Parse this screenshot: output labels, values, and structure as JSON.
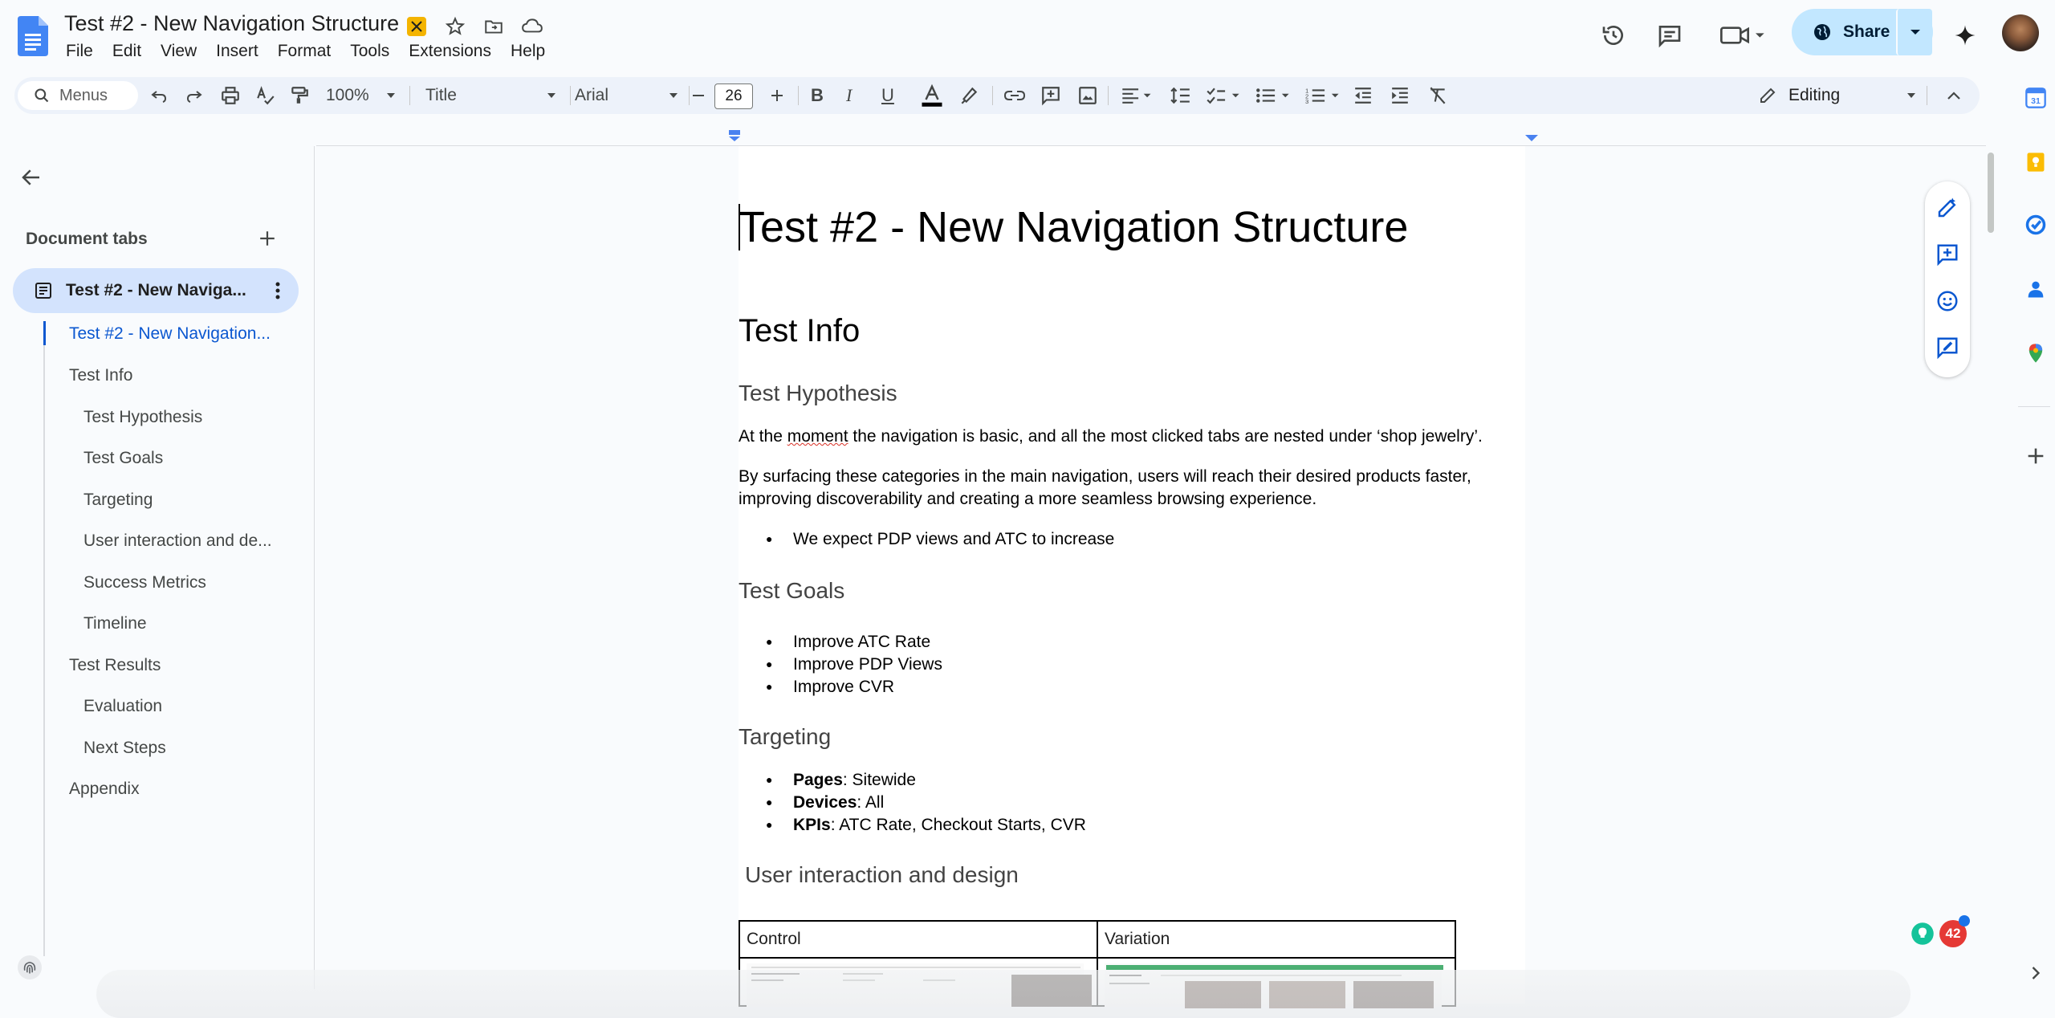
{
  "app": {
    "doc_title": "Test #2 - New Navigation Structure",
    "menu": [
      "File",
      "Edit",
      "View",
      "Insert",
      "Format",
      "Tools",
      "Extensions",
      "Help"
    ],
    "share_label": "Share"
  },
  "toolbar": {
    "menus_label": "Menus",
    "zoom": "100%",
    "style": "Title",
    "font": "Arial",
    "font_size": "26",
    "mode": "Editing"
  },
  "sidebar": {
    "heading": "Document tabs",
    "active_tab": "Test #2 - New Naviga...",
    "outline": [
      "Test #2 - New Navigation...",
      "Test Info",
      "Test Hypothesis",
      "Test Goals",
      "Targeting",
      "User interaction and de...",
      "Success Metrics",
      "Timeline",
      "Test Results",
      "Evaluation",
      "Next Steps",
      "Appendix"
    ]
  },
  "doc": {
    "title": "Test #2 - New Navigation Structure",
    "test_info": "Test Info",
    "hypothesis_heading": "Test Hypothesis",
    "hyp_p1_a": "At the ",
    "hyp_p1_b": "moment",
    "hyp_p1_c": " the navigation is basic, and all the most clicked tabs are nested under ‘shop jewelry’.",
    "hyp_p2": "By surfacing these categories in the main navigation, users will reach their desired products faster, improving discoverability and creating a more seamless browsing experience.",
    "hyp_bullet": "We expect PDP views and ATC to increase",
    "goals_heading": "Test Goals",
    "goals": [
      "Improve ATC Rate",
      "Improve PDP Views",
      "Improve CVR"
    ],
    "targeting_heading": "Targeting",
    "targeting": [
      {
        "k": "Pages",
        "v": ": Sitewide"
      },
      {
        "k": "Devices",
        "v": ": All"
      },
      {
        "k": "KPIs",
        "v": ": ATC Rate, Checkout Starts, CVR"
      }
    ],
    "ux_heading": "User interaction and design",
    "table_control": "Control",
    "table_variation": "Variation"
  },
  "badge_count": "42",
  "colors": {
    "accent": "#0b57d0",
    "share_bg": "#c2e7ff",
    "active_tab_bg": "#d3e3fd",
    "toolbar_bg": "#edf2fa"
  }
}
